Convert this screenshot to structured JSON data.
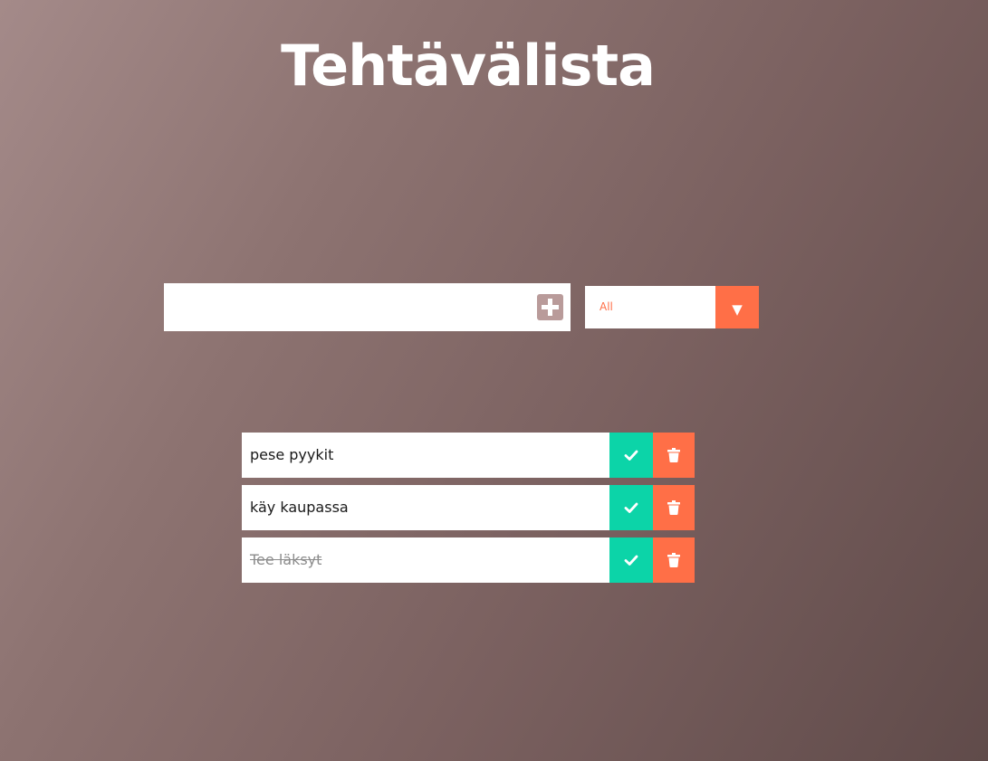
{
  "app": {
    "title": "Tehtävälista"
  },
  "add_form": {
    "input_value": "",
    "add_icon": "plus-square-icon"
  },
  "filter": {
    "selected": "All",
    "arrow_icon": "triangle-down-icon"
  },
  "todos": [
    {
      "text": "pese pyykit",
      "completed": false
    },
    {
      "text": "käy kaupassa",
      "completed": false
    },
    {
      "text": "Tee läksyt",
      "completed": true
    }
  ],
  "icons": {
    "complete": "check-icon",
    "delete": "trash-icon"
  },
  "colors": {
    "accent_orange": "#ff6f47",
    "accent_green": "#0cd4a8",
    "add_icon": "#b99b9a",
    "background_start": "#a48a89",
    "background_end": "#604b4a"
  }
}
